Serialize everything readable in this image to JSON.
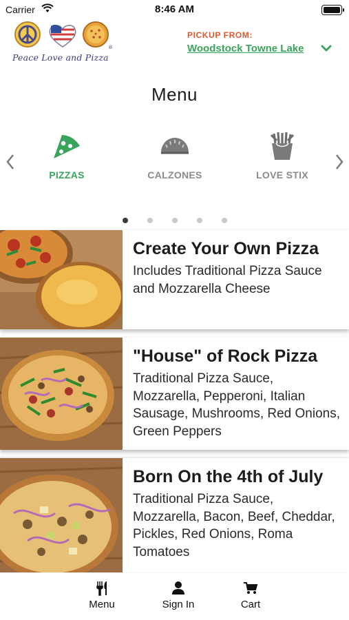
{
  "status_bar": {
    "carrier": "Carrier",
    "time": "8:46 AM"
  },
  "brand": {
    "name": "Peace Love and Pizza",
    "registered_mark": "®"
  },
  "pickup": {
    "label": "PICKUP FROM:",
    "store": "Woodstock Towne Lake"
  },
  "page_title": "Menu",
  "categories": [
    {
      "label": "PIZZAS",
      "icon": "pizza-slice-icon",
      "active": true
    },
    {
      "label": "CALZONES",
      "icon": "calzone-icon",
      "active": false
    },
    {
      "label": "LOVE STIX",
      "icon": "fries-icon",
      "active": false
    }
  ],
  "carousel": {
    "pages": 5,
    "current": 1
  },
  "products": [
    {
      "title": "Create Your Own Pizza",
      "description": "Includes Traditional Pizza Sauce and Mozzarella Cheese"
    },
    {
      "title": "\"House\" of Rock Pizza",
      "description": "Traditional Pizza Sauce, Mozzarella, Pepperoni, Italian Sausage, Mushrooms, Red Onions, Green Peppers"
    },
    {
      "title": "Born On the 4th of July",
      "description": "Traditional Pizza Sauce, Mozzarella, Bacon, Beef, Cheddar, Pickles, Red Onions, Roma Tomatoes"
    }
  ],
  "tabs": [
    {
      "label": "Menu",
      "icon": "fork-knife-icon"
    },
    {
      "label": "Sign In",
      "icon": "person-icon"
    },
    {
      "label": "Cart",
      "icon": "cart-icon"
    }
  ],
  "colors": {
    "accent_green": "#3aa45b",
    "pickup_orange": "#e0572d",
    "inactive_gray": "#8a8a8a"
  }
}
